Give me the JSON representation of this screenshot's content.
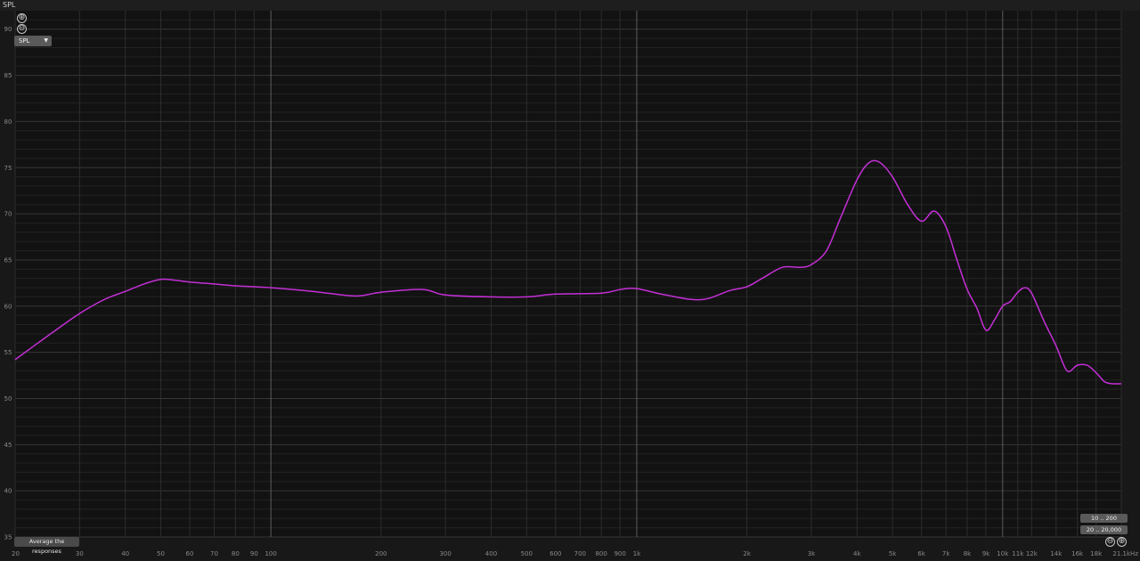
{
  "window": {
    "title": "SPL"
  },
  "controls": {
    "zoom_in_icon": "⊕",
    "zoom_out_icon": "⊖",
    "measure_select": "SPL",
    "average_button": "Average the responses",
    "range_buttons": [
      "10 .. 200",
      "20 .. 20,000"
    ],
    "bottom_zoom_out_icon": "⊖",
    "bottom_zoom_in_icon": "⊕"
  },
  "chart_data": {
    "type": "line",
    "xscale": "log",
    "xlim": [
      20,
      21100
    ],
    "ylim": [
      35,
      92
    ],
    "grid": true,
    "series_color": "#c42fd6",
    "y_ticks": [
      35,
      40,
      45,
      50,
      55,
      60,
      65,
      70,
      75,
      80,
      85,
      90
    ],
    "y_tick_labels": [
      "35",
      "40",
      "45",
      "50",
      "55",
      "60",
      "65",
      "70",
      "75",
      "80",
      "85",
      "90"
    ],
    "x_ticks": [
      20,
      30,
      40,
      50,
      60,
      70,
      80,
      90,
      100,
      200,
      300,
      400,
      500,
      600,
      700,
      800,
      900,
      1000,
      2000,
      3000,
      4000,
      5000,
      6000,
      7000,
      8000,
      9000,
      10000,
      11000,
      12000,
      14000,
      16000,
      18000,
      21100
    ],
    "x_tick_labels": [
      "20",
      "30",
      "40",
      "50",
      "60",
      "70",
      "80",
      "90",
      "100",
      "200",
      "300",
      "400",
      "500",
      "600",
      "700",
      "800",
      "900",
      "1k",
      "2k",
      "3k",
      "4k",
      "5k",
      "6k",
      "7k",
      "8k",
      "9k",
      "10k",
      "11k",
      "12k",
      "14k",
      "16k",
      "18k",
      "21.1kHz"
    ],
    "x": [
      20,
      25,
      30,
      35,
      40,
      45,
      50,
      55,
      60,
      70,
      80,
      100,
      130,
      170,
      200,
      260,
      300,
      400,
      500,
      600,
      800,
      900,
      1000,
      1200,
      1500,
      1800,
      2000,
      2200,
      2500,
      2800,
      3000,
      3300,
      3600,
      4000,
      4300,
      4600,
      5000,
      5500,
      6000,
      6500,
      7000,
      7500,
      8000,
      8500,
      9000,
      9500,
      10000,
      10500,
      11000,
      11500,
      12000,
      13000,
      14000,
      15000,
      16000,
      17000,
      18000,
      19000,
      20000,
      21100
    ],
    "y": [
      54.2,
      57.0,
      59.2,
      60.7,
      61.6,
      62.4,
      62.9,
      62.8,
      62.6,
      62.4,
      62.2,
      62.0,
      61.6,
      61.1,
      61.5,
      61.8,
      61.2,
      61.0,
      61.0,
      61.3,
      61.4,
      61.8,
      61.9,
      61.2,
      60.7,
      61.7,
      62.1,
      63.0,
      64.2,
      64.2,
      64.5,
      66.0,
      69.5,
      73.7,
      75.5,
      75.6,
      74.0,
      71.0,
      69.2,
      70.3,
      68.6,
      65.0,
      61.8,
      59.8,
      57.4,
      58.5,
      60.0,
      60.5,
      61.5,
      62.0,
      61.4,
      58.3,
      55.7,
      53.0,
      53.6,
      53.6,
      52.8,
      51.8,
      51.6,
      51.6
    ]
  }
}
